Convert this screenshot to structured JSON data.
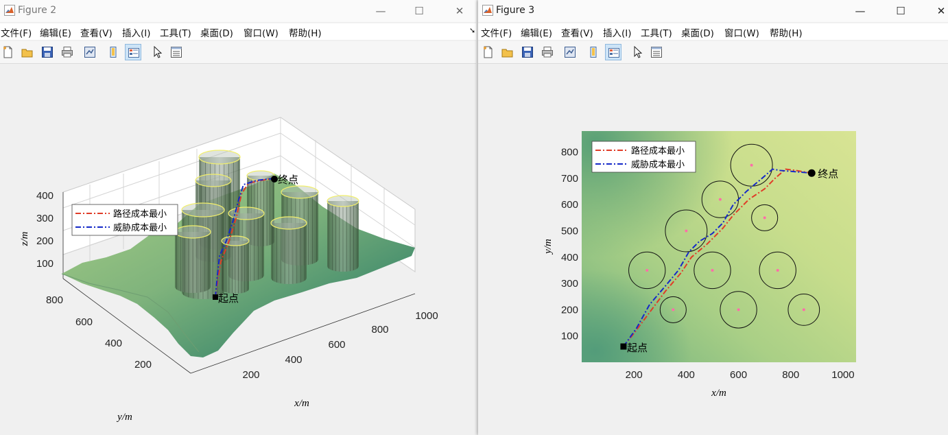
{
  "figure2": {
    "title": "Figure 2",
    "menu": [
      "文件(F)",
      "编辑(E)",
      "查看(V)",
      "插入(I)",
      "工具(T)",
      "桌面(D)",
      "窗口(W)",
      "帮助(H)"
    ],
    "toolbar_icons": [
      "new-figure-icon",
      "open-file-icon",
      "save-icon",
      "print-icon",
      "link-plot-icon",
      "hide-plot-tools-icon",
      "show-plot-tools-icon",
      "edit-plot-pointer-icon",
      "property-inspector-icon"
    ],
    "plot": {
      "z_label": "z/m",
      "x_label": "x/m",
      "y_label": "y/m",
      "z_ticks": [
        "400",
        "300",
        "200",
        "100"
      ],
      "y_ticks": [
        "800",
        "600",
        "400",
        "200"
      ],
      "x_ticks": [
        "200",
        "400",
        "600",
        "800",
        "1000"
      ],
      "legend": [
        "路径成本最小",
        "威胁成本最小"
      ],
      "start_label": "起点",
      "end_label": "终点"
    }
  },
  "figure3": {
    "title": "Figure 3",
    "menu": [
      "文件(F)",
      "编辑(E)",
      "查看(V)",
      "插入(I)",
      "工具(T)",
      "桌面(D)",
      "窗口(W)",
      "帮助(H)"
    ],
    "toolbar_icons": [
      "new-figure-icon",
      "open-file-icon",
      "save-icon",
      "print-icon",
      "link-plot-icon",
      "hide-plot-tools-icon",
      "show-plot-tools-icon",
      "edit-plot-pointer-icon",
      "property-inspector-icon"
    ],
    "plot": {
      "x_label": "x/m",
      "y_label": "y/m",
      "x_ticks": [
        "200",
        "400",
        "600",
        "800",
        "1000"
      ],
      "y_ticks": [
        "800",
        "700",
        "600",
        "500",
        "400",
        "300",
        "200",
        "100"
      ],
      "legend": [
        "路径成本最小",
        "威胁成本最小"
      ],
      "start_label": "起点",
      "end_label": "终点"
    }
  },
  "colors": {
    "path_cost_line": "#e03c28",
    "threat_cost_line": "#1428c8",
    "threat_center": "#ff6ea8"
  },
  "chart_data": [
    {
      "type": "scatter",
      "name_hint": "2D threat map (Figure 3)",
      "xlim": [
        0,
        1050
      ],
      "ylim": [
        0,
        880
      ],
      "x_ticks": [
        200,
        400,
        600,
        800,
        1000
      ],
      "y_ticks": [
        100,
        200,
        300,
        400,
        500,
        600,
        700,
        800
      ],
      "xlabel": "x/m",
      "ylabel": "y/m",
      "legend_position": "top-left",
      "threats": [
        {
          "x": 650,
          "y": 750,
          "r": 80
        },
        {
          "x": 530,
          "y": 620,
          "r": 70
        },
        {
          "x": 700,
          "y": 550,
          "r": 50
        },
        {
          "x": 400,
          "y": 500,
          "r": 80
        },
        {
          "x": 250,
          "y": 350,
          "r": 70
        },
        {
          "x": 500,
          "y": 350,
          "r": 70
        },
        {
          "x": 750,
          "y": 350,
          "r": 70
        },
        {
          "x": 350,
          "y": 200,
          "r": 50
        },
        {
          "x": 600,
          "y": 200,
          "r": 70
        },
        {
          "x": 850,
          "y": 200,
          "r": 60
        }
      ],
      "series": [
        {
          "name": "路径成本最小",
          "x": [
            160,
            200,
            260,
            320,
            380,
            420,
            480,
            540,
            580,
            640,
            700,
            740,
            780,
            820,
            880
          ],
          "y": [
            60,
            110,
            190,
            270,
            340,
            400,
            450,
            510,
            560,
            620,
            660,
            700,
            735,
            730,
            720
          ]
        },
        {
          "name": "威胁成本最小",
          "x": [
            160,
            210,
            260,
            320,
            370,
            410,
            450,
            500,
            540,
            580,
            630,
            690,
            730,
            760,
            880
          ],
          "y": [
            60,
            130,
            220,
            290,
            350,
            420,
            460,
            490,
            530,
            600,
            650,
            700,
            735,
            730,
            720
          ]
        }
      ],
      "start": {
        "x": 160,
        "y": 60
      },
      "end": {
        "x": 880,
        "y": 720
      }
    }
  ]
}
